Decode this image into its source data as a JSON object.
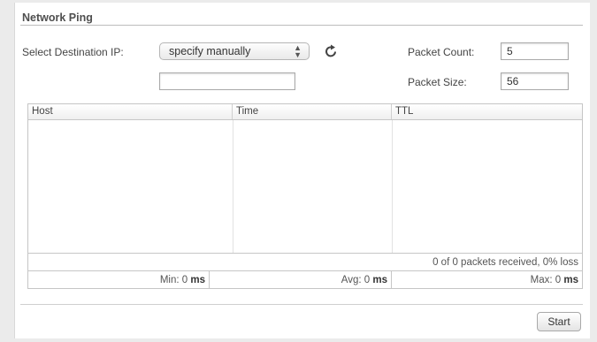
{
  "panel": {
    "title": "Network Ping"
  },
  "form": {
    "destination_label": "Select Destination IP:",
    "destination_selected": "specify manually",
    "manual_ip_value": "",
    "packet_count_label": "Packet Count:",
    "packet_count_value": "5",
    "packet_size_label": "Packet Size:",
    "packet_size_value": "56"
  },
  "results": {
    "columns": [
      "Host",
      "Time",
      "TTL"
    ],
    "rows": [],
    "summary": "0 of 0 packets received, 0% loss",
    "min_label": "Min: 0",
    "avg_label": "Avg: 0",
    "max_label": "Max: 0",
    "unit": "ms"
  },
  "actions": {
    "start_label": "Start"
  },
  "icons": {
    "refresh": "refresh-icon",
    "select_arrows": "up-down-arrows-icon"
  }
}
